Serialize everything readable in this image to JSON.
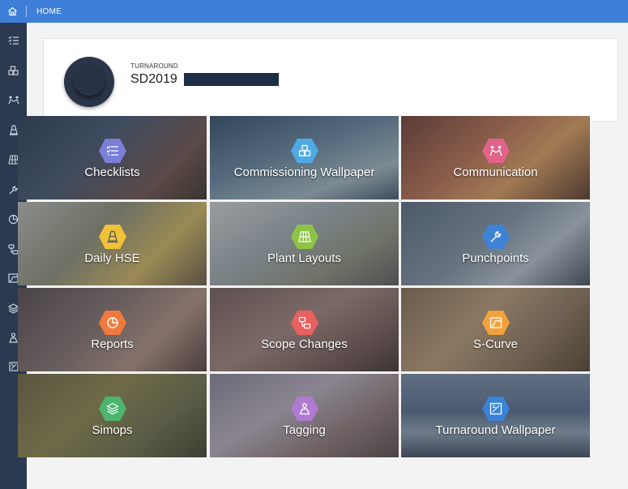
{
  "topbar": {
    "breadcrumb": "HOME"
  },
  "sidebar": {
    "items": [
      {
        "icon": "checklist-icon"
      },
      {
        "icon": "commissioning-icon"
      },
      {
        "icon": "communication-icon"
      },
      {
        "icon": "hse-cone-icon"
      },
      {
        "icon": "plant-layout-icon"
      },
      {
        "icon": "wrench-icon"
      },
      {
        "icon": "pie-chart-icon"
      },
      {
        "icon": "scope-changes-icon"
      },
      {
        "icon": "s-curve-icon"
      },
      {
        "icon": "layers-icon"
      },
      {
        "icon": "tagging-icon"
      },
      {
        "icon": "wallpaper-icon"
      }
    ]
  },
  "header": {
    "kind": "TURNAROUND",
    "title": "SD2019"
  },
  "tiles": [
    {
      "label": "Checklists",
      "icon": "checklist-icon",
      "color": "#7b7fd8"
    },
    {
      "label": "Commissioning Wallpaper",
      "icon": "commissioning-icon",
      "color": "#4fa9e4"
    },
    {
      "label": "Communication",
      "icon": "communication-icon",
      "color": "#e0648a"
    },
    {
      "label": "Daily HSE",
      "icon": "hse-cone-icon",
      "color": "#f0c23a"
    },
    {
      "label": "Plant Layouts",
      "icon": "plant-layout-icon",
      "color": "#8ec446"
    },
    {
      "label": "Punchpoints",
      "icon": "wrench-icon",
      "color": "#3f83d6"
    },
    {
      "label": "Reports",
      "icon": "pie-chart-icon",
      "color": "#f07a3e"
    },
    {
      "label": "Scope Changes",
      "icon": "scope-changes-icon",
      "color": "#e8605f"
    },
    {
      "label": "S-Curve",
      "icon": "s-curve-icon",
      "color": "#f3a13c"
    },
    {
      "label": "Simops",
      "icon": "layers-icon",
      "color": "#4cb56e"
    },
    {
      "label": "Tagging",
      "icon": "tagging-icon",
      "color": "#b07ad0"
    },
    {
      "label": "Turnaround Wallpaper",
      "icon": "wallpaper-icon",
      "color": "#3a83d8"
    }
  ]
}
